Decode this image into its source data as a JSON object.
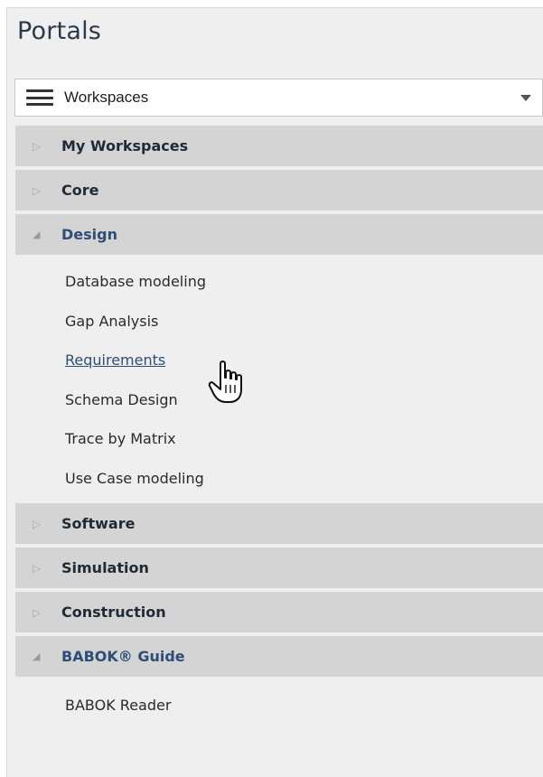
{
  "panel": {
    "title": "Portals"
  },
  "selector": {
    "label": "Workspaces",
    "icon": "hamburger-menu-icon"
  },
  "groups": [
    {
      "label": "My Workspaces",
      "expanded": false
    },
    {
      "label": "Core",
      "expanded": false
    },
    {
      "label": "Design",
      "expanded": true,
      "items": [
        {
          "label": "Database modeling"
        },
        {
          "label": "Gap Analysis"
        },
        {
          "label": "Requirements",
          "hovered": true
        },
        {
          "label": "Schema Design"
        },
        {
          "label": "Trace by Matrix"
        },
        {
          "label": "Use Case modeling"
        }
      ]
    },
    {
      "label": "Software",
      "expanded": false
    },
    {
      "label": "Simulation",
      "expanded": false
    },
    {
      "label": "Construction",
      "expanded": false
    },
    {
      "label": "BABOK® Guide",
      "expanded": true,
      "items": [
        {
          "label": "BABOK Reader"
        }
      ]
    }
  ],
  "colors": {
    "header_bg": "#d4d4d4",
    "panel_bg": "#efefef",
    "expanded_label": "#2e4e77",
    "link": "#2f4f7a"
  }
}
